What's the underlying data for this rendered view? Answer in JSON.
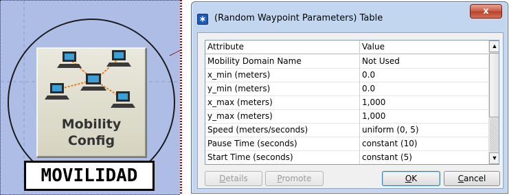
{
  "canvas": {
    "node": {
      "label_line1": "Mobility",
      "label_line2": "Config",
      "icon": "network-nodes-icon"
    },
    "name_label": "MOVILIDAD"
  },
  "window": {
    "title": "(Random Waypoint Parameters) Table",
    "icon": "app-star-icon",
    "close_label": "x"
  },
  "table": {
    "headers": [
      "Attribute",
      "Value"
    ],
    "rows": [
      {
        "attribute": "Mobility Domain Name",
        "value": "Not Used"
      },
      {
        "attribute": "x_min (meters)",
        "value": "0.0"
      },
      {
        "attribute": "y_min (meters)",
        "value": "0.0"
      },
      {
        "attribute": "x_max (meters)",
        "value": "1,000"
      },
      {
        "attribute": "y_max (meters)",
        "value": "1,000"
      },
      {
        "attribute": "Speed (meters/seconds)",
        "value": "uniform (0, 5)"
      },
      {
        "attribute": "Pause Time (seconds)",
        "value": "constant (10)"
      },
      {
        "attribute": "Start Time (seconds)",
        "value": "constant (5)"
      }
    ]
  },
  "buttons": {
    "details": {
      "first": "D",
      "rest": "etails"
    },
    "promote": {
      "first": "P",
      "rest": "romote"
    },
    "ok": {
      "first": "O",
      "rest": "K"
    },
    "cancel": {
      "first": "C",
      "rest": "ancel"
    }
  },
  "colors": {
    "canvas_bg": "#aebde6",
    "window_frame": "#c2d6ef",
    "close_button": "#c75a42"
  }
}
